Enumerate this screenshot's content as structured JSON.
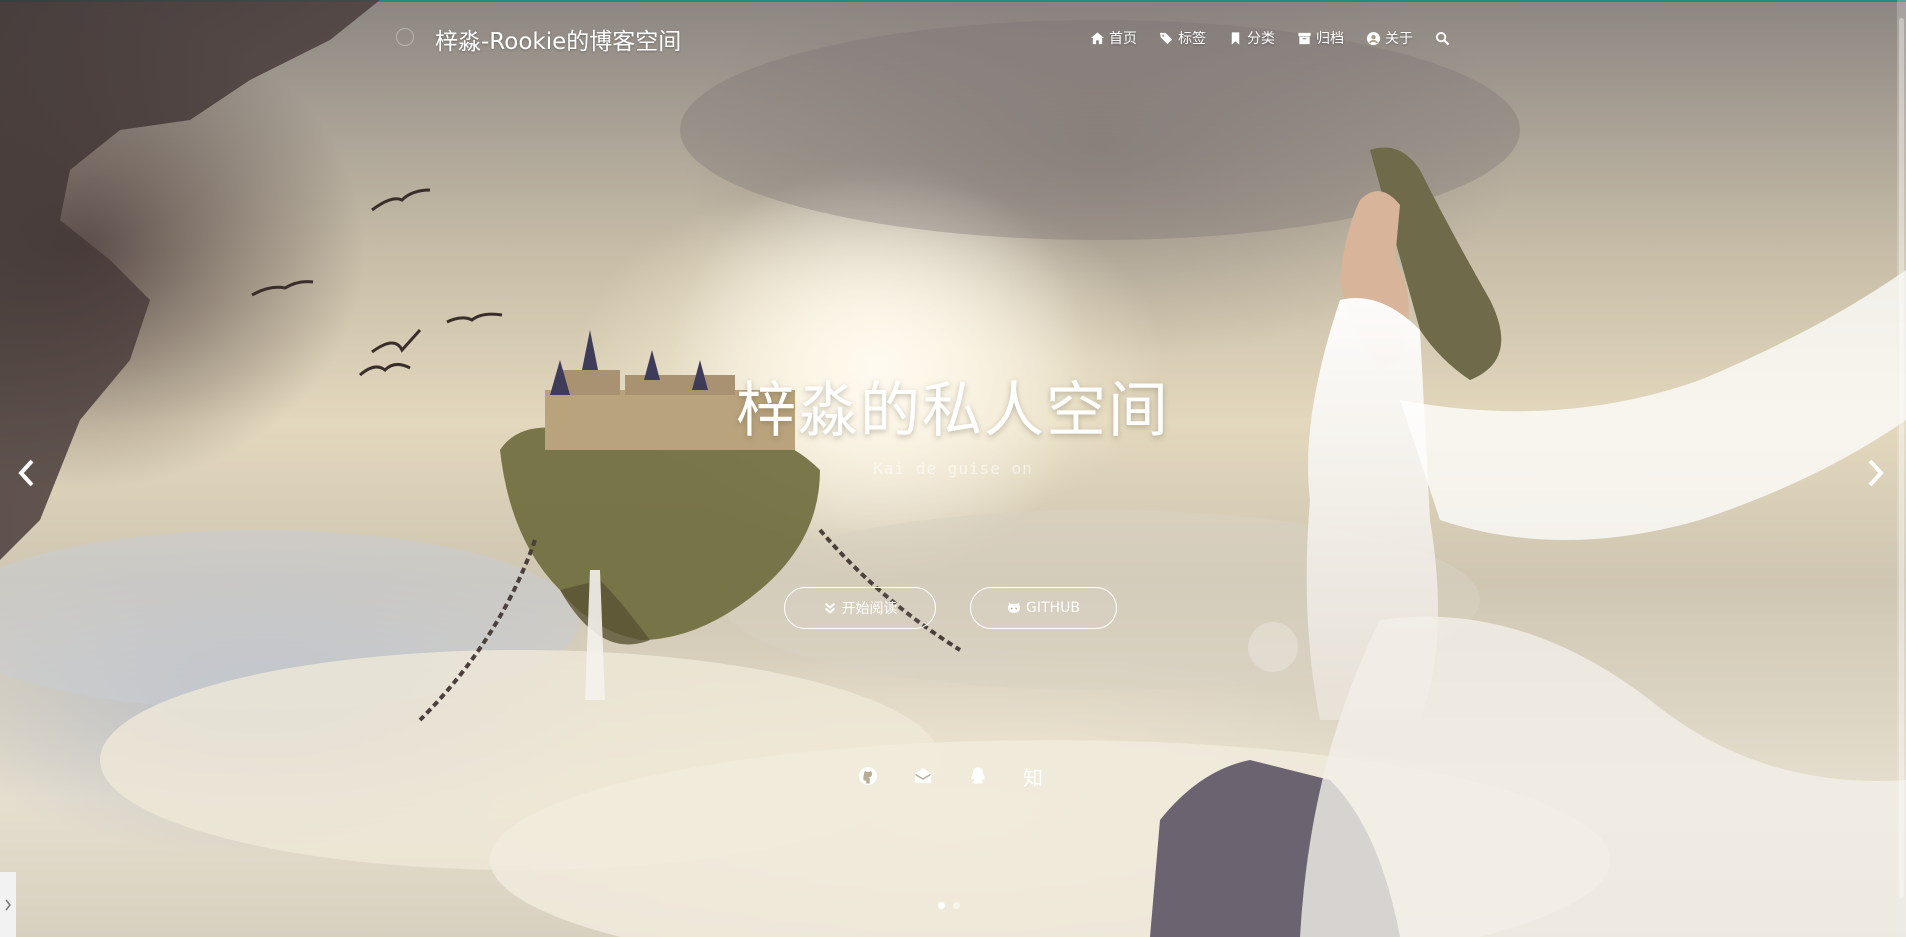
{
  "navbar": {
    "brand": "梓淼-Rookie的博客空间",
    "items": [
      {
        "label": "首页",
        "icon": "home-icon"
      },
      {
        "label": "标签",
        "icon": "tags-icon"
      },
      {
        "label": "分类",
        "icon": "bookmark-icon"
      },
      {
        "label": "归档",
        "icon": "archive-icon"
      },
      {
        "label": "关于",
        "icon": "user-circle-icon"
      }
    ],
    "search_icon": "search-icon"
  },
  "hero": {
    "title": "梓淼的私人空间",
    "subtitle": "Kai de guise on",
    "buttons": {
      "read": "开始阅读",
      "github": "GITHUB"
    },
    "social": {
      "zhihu": "知"
    },
    "carousel": {
      "slides": 2,
      "active_index": 0
    }
  },
  "colors": {
    "accent_line": "#1f8c8c",
    "text": "#ffffff"
  }
}
